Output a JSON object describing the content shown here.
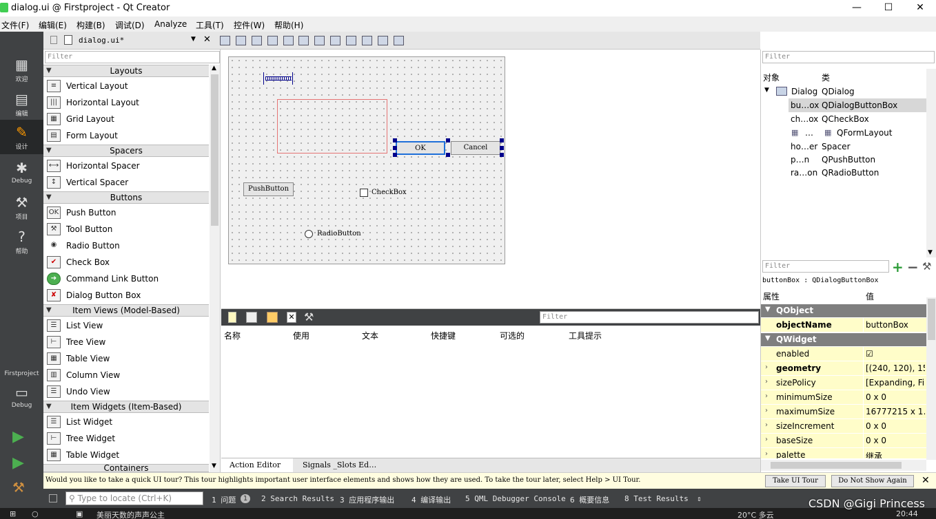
{
  "window": {
    "title": "dialog.ui @ Firstproject - Qt Creator",
    "minimize": "—",
    "maximize": "☐",
    "close": "✕"
  },
  "menu": [
    "文件(F)",
    "编辑(E)",
    "构建(B)",
    "调试(D)",
    "Analyze",
    "工具(T)",
    "控件(W)",
    "帮助(H)"
  ],
  "modes": {
    "welcome": "欢迎",
    "edit": "编辑",
    "design": "设计",
    "debug": "Debug",
    "projects": "项目",
    "help": "帮助",
    "project_name": "Firstproject",
    "kit": "Debug"
  },
  "editor_toolbar": {
    "file_name": "dialog.ui*"
  },
  "widget_box": {
    "filter_placeholder": "Filter",
    "categories": {
      "layouts": "Layouts",
      "spacers": "Spacers",
      "buttons": "Buttons",
      "item_views": "Item Views (Model-Based)",
      "item_widgets": "Item Widgets (Item-Based)",
      "containers": "Containers"
    },
    "items": {
      "vertical_layout": "Vertical Layout",
      "horizontal_layout": "Horizontal Layout",
      "grid_layout": "Grid Layout",
      "form_layout": "Form Layout",
      "horizontal_spacer": "Horizontal Spacer",
      "vertical_spacer": "Vertical Spacer",
      "push_button": "Push Button",
      "tool_button": "Tool Button",
      "radio_button": "Radio Button",
      "check_box": "Check Box",
      "command_link_button": "Command Link Button",
      "dialog_button_box": "Dialog Button Box",
      "list_view": "List View",
      "tree_view": "Tree View",
      "table_view": "Table View",
      "column_view": "Column View",
      "undo_view": "Undo View",
      "list_widget": "List Widget",
      "tree_widget": "Tree Widget",
      "table_widget": "Table Widget"
    }
  },
  "form": {
    "ok": "OK",
    "cancel": "Cancel",
    "push_button": "PushButton",
    "check_box": "CheckBox",
    "radio_button": "RadioButton"
  },
  "action_editor": {
    "filter_placeholder": "Filter",
    "columns": [
      "名称",
      "使用",
      "文本",
      "快捷键",
      "可选的",
      "工具提示"
    ],
    "tab_action_editor": "Action Editor",
    "tab_signals_slots": "Signals _Slots Ed…"
  },
  "object_inspector": {
    "filter_placeholder": "Filter",
    "header_object": "对象",
    "header_class": "类",
    "rows": [
      {
        "object": "Dialog",
        "class": "QDialog"
      },
      {
        "object": "bu…ox",
        "class": "QDialogButtonBox"
      },
      {
        "object": "ch…ox",
        "class": "QCheckBox"
      },
      {
        "object": "…",
        "class": "QFormLayout"
      },
      {
        "object": "ho…er",
        "class": "Spacer"
      },
      {
        "object": "p…n",
        "class": "QPushButton"
      },
      {
        "object": "ra…on",
        "class": "QRadioButton"
      }
    ]
  },
  "property_editor": {
    "filter_placeholder": "Filter",
    "class_info": "buttonBox : QDialogButtonBox",
    "header_property": "属性",
    "header_value": "值",
    "group_qobject": "QObject",
    "group_qwidget": "QWidget",
    "rows": [
      {
        "name": "objectName",
        "value": "buttonBox"
      },
      {
        "name": "enabled",
        "value": "☑"
      },
      {
        "name": "geometry",
        "value": "[(240, 120), 15…"
      },
      {
        "name": "sizePolicy",
        "value": "[Expanding, Fi…"
      },
      {
        "name": "minimumSize",
        "value": "0 x 0"
      },
      {
        "name": "maximumSize",
        "value": "16777215 x 1…"
      },
      {
        "name": "sizeIncrement",
        "value": "0 x 0"
      },
      {
        "name": "baseSize",
        "value": "0 x 0"
      },
      {
        "name": "palette",
        "value": "继承"
      }
    ]
  },
  "tour": {
    "message": "Would you like to take a quick UI tour? This tour highlights important user interface elements and shows how they are used. To take the tour later, select Help > UI Tour.",
    "take_tour": "Take UI Tour",
    "dont_show": "Do Not Show Again",
    "close": "✕"
  },
  "output": {
    "locator_placeholder": "Type to locate (Ctrl+K)",
    "tabs": [
      "1 问题",
      "2 Search Results",
      "3 应用程序输出",
      "4 编译输出",
      "5 QML Debugger Console",
      "6 概要信息",
      "8 Test Results"
    ],
    "issues_count": "1"
  },
  "taskbar": {
    "weather": "20°C 多云",
    "time": "20:44",
    "notice": "美丽天数的声声公主"
  },
  "watermark": "CSDN @Gigi Princess"
}
